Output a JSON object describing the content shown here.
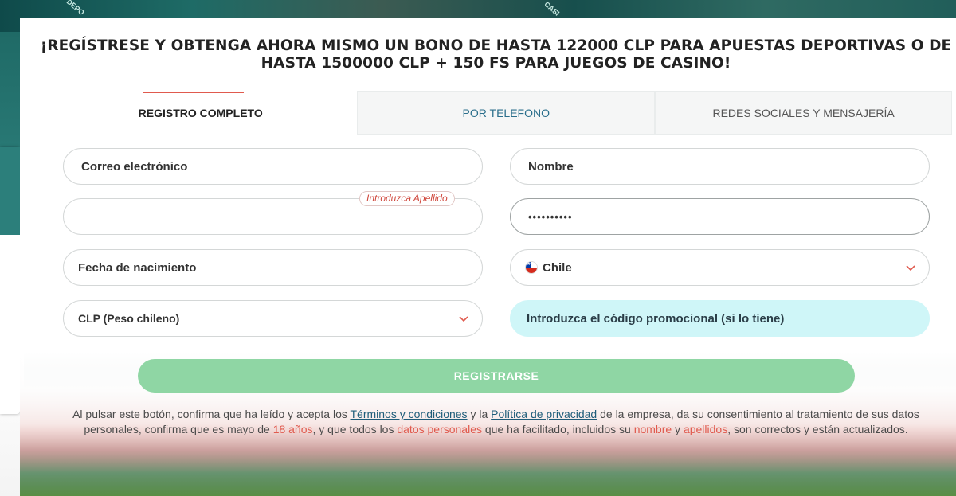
{
  "background": {
    "badges": [
      "DEPO",
      "CASI"
    ]
  },
  "modal": {
    "title": "¡REGÍSTRESE Y OBTENGA AHORA MISMO UN BONO DE HASTA 122000 CLP PARA APUESTAS DEPORTIVAS O DE HASTA 1500000 CLP + 150 FS PARA JUEGOS DE CASINO!",
    "tabs": [
      {
        "label": "REGISTRO COMPLETO",
        "active": true
      },
      {
        "label": "POR TELEFONO",
        "active": false
      },
      {
        "label": "REDES SOCIALES Y MENSAJERÍA",
        "active": false
      }
    ],
    "form": {
      "email_placeholder": "Correo electrónico",
      "name_placeholder": "Nombre",
      "surname_value": "",
      "surname_hint": "Introduzca Apellido",
      "password_value": "••••••••••",
      "birthdate_placeholder": "Fecha de nacimiento",
      "country_value": "Chile",
      "currency_value": "CLP (Peso chileno)",
      "promo_placeholder": "Introduzca el código promocional (si lo tiene)"
    },
    "register_label": "REGISTRARSE",
    "disclaimer": {
      "part1": "Al pulsar este botón, confirma que ha leído y acepta los ",
      "terms_link": "Términos y condiciones",
      "part2": " y la ",
      "privacy_link": "Política de privacidad",
      "part3": " de la empresa, da su consentimiento al tratamiento de sus datos personales, confirma que es mayo de ",
      "age": "18 años",
      "part4": ", y que todos los ",
      "personal_data": "datos personales",
      "part5": " que ha facilitado, incluidos su ",
      "name_word": "nombre",
      "part6": " y ",
      "surname_word": "apellidos",
      "part7": ", son correctos y están actualizados."
    }
  },
  "colors": {
    "accent_red": "#e05a4e",
    "button_green": "#8fd6a4",
    "promo_bg": "#cff6f8",
    "link_blue": "#1f5d7a"
  }
}
